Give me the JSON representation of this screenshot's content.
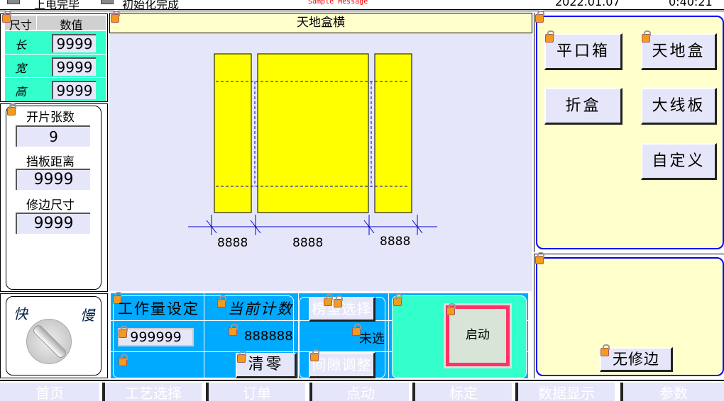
{
  "status": {
    "power": "上电完毕",
    "init": "初始化完成",
    "message": "Sample Message",
    "date": "2022.01.07",
    "time": "0:40:21"
  },
  "dims": {
    "header_size": "尺寸",
    "header_value": "数值",
    "rows": [
      {
        "label": "长",
        "value": "9999"
      },
      {
        "label": "宽",
        "value": "9999"
      },
      {
        "label": "高",
        "value": "9999"
      }
    ]
  },
  "params": {
    "sheets_label": "开片张数",
    "sheets": "9",
    "baffle_label": "挡板距离",
    "baffle": "9999",
    "trim_label": "修边尺寸",
    "trim": "9999"
  },
  "speed": {
    "fast": "快",
    "slow": "慢"
  },
  "drawing": {
    "title": "天地盒横",
    "dim1": "8888",
    "dim2": "8888",
    "dim3": "8888"
  },
  "work": {
    "set_label": "工作量设定",
    "count_label": "当前计数",
    "set_value": "999999",
    "count_value": "888888",
    "clear": "清零",
    "type_select": "楞型选择",
    "type_value": "未选",
    "gap_adjust": "间隙调整",
    "start": "启动"
  },
  "box_types": [
    "平口箱",
    "天地盒",
    "折盒",
    "大线板",
    "自定义"
  ],
  "no_trim": "无修边",
  "nav": [
    "首页",
    "工艺选择",
    "订单",
    "点动",
    "标定",
    "数据显示",
    "参数"
  ],
  "colors": {
    "cyan": "#33ffcc",
    "blue": "#00aaff",
    "lavender": "#e6e6fa",
    "cream": "#ffffcc",
    "yellow": "#ffff00"
  }
}
